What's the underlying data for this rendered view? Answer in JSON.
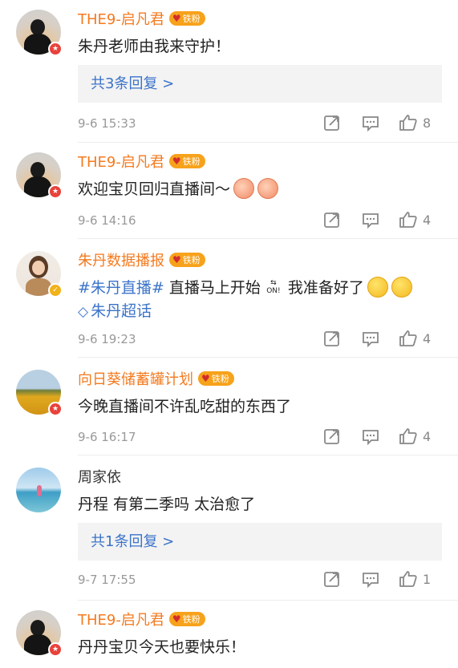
{
  "comments": [
    {
      "name": "THE9-启凡君",
      "name_color": "#f47a1f",
      "fan_badge": "铁粉",
      "avatar_badge": "red",
      "text": "朱丹老师由我来守护！",
      "reply": "共3条回复 >",
      "time": "9-6 15:33",
      "likes": "8"
    },
    {
      "name": "THE9-启凡君",
      "name_color": "#f47a1f",
      "fan_badge": "铁粉",
      "avatar_badge": "red",
      "text": "欢迎宝贝回归直播间～",
      "emojis": [
        "pink-face-emoji",
        "pink-face-emoji"
      ],
      "time": "9-6 14:16",
      "likes": "4"
    },
    {
      "name": "朱丹数据播报",
      "name_color": "#f47a1f",
      "fan_badge": "铁粉",
      "avatar_badge": "gold",
      "topic": "#朱丹直播#",
      "text": "直播马上开始",
      "on_icon": "ON!",
      "text2": "我准备好了",
      "emojis": [
        "scared-face-emoji",
        "scared-face-emoji"
      ],
      "super_topic": "朱丹超话",
      "time": "9-6 19:23",
      "likes": "4"
    },
    {
      "name": "向日葵储蓄罐计划",
      "name_color": "#f47a1f",
      "fan_badge": "铁粉",
      "avatar_badge": "red",
      "text": "今晚直播间不许乱吃甜的东西了",
      "time": "9-6 16:17",
      "likes": "4"
    },
    {
      "name": "周家依",
      "name_color": "#333333",
      "text": "丹程 有第二季吗 太治愈了",
      "reply": "共1条回复 >",
      "time": "9-7 17:55",
      "likes": "1"
    },
    {
      "name": "THE9-启凡君",
      "name_color": "#f47a1f",
      "fan_badge": "铁粉",
      "avatar_badge": "red",
      "text": "丹丹宝贝今天也要快乐！"
    }
  ],
  "icons": {
    "share": "share-icon",
    "comment": "comment-icon",
    "like": "like-icon"
  },
  "colors": {
    "name_orange": "#f47a1f",
    "link_blue": "#3b73c9",
    "meta_gray": "#999999"
  }
}
